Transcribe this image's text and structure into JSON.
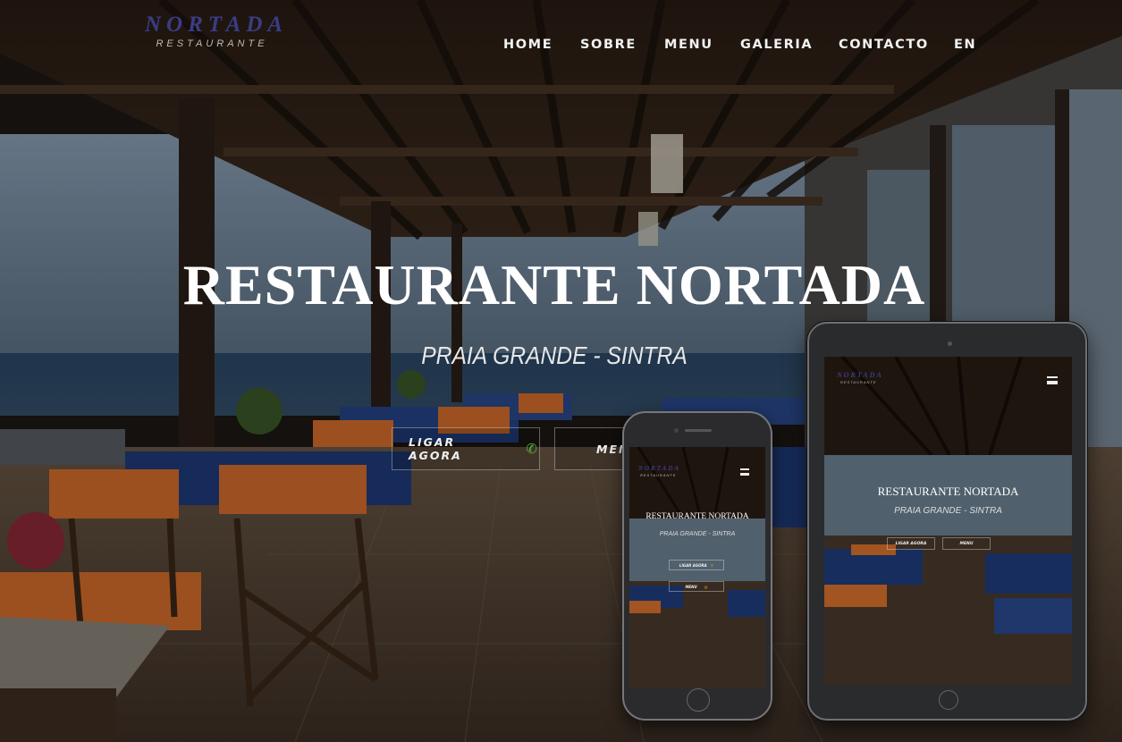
{
  "logo": {
    "name": "NORTADA",
    "subtitle": "RESTAURANTE"
  },
  "nav": {
    "items": [
      "HOME",
      "SOBRE",
      "MENU",
      "GALERIA",
      "CONTACTO",
      "EN"
    ]
  },
  "hero": {
    "title": "RESTAURANTE NORTADA",
    "subtitle": "PRAIA GRANDE - SINTRA",
    "call_label": "LIGAR AGORA",
    "menu_label": "MENU"
  },
  "icons": {
    "call": "phone-icon",
    "nav_toggle": "hamburger-icon",
    "menu": "menu-book-icon"
  },
  "colors": {
    "logo": "#3b3c86",
    "call_icon": "#59b43e",
    "chair_orange": "#d8702c",
    "tablecloth_blue": "#1f3c7c"
  }
}
